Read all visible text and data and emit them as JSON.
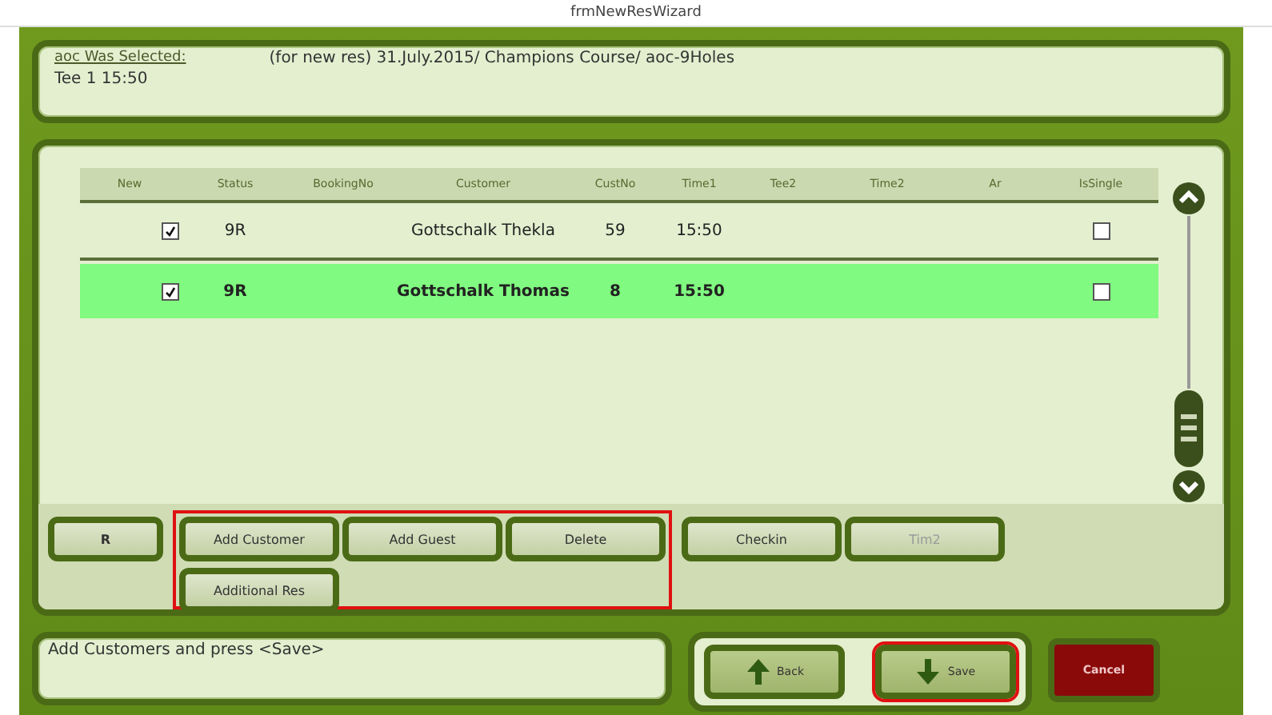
{
  "window": {
    "title": "frmNewResWizard"
  },
  "info": {
    "label": "aoc Was Selected:",
    "details": "(for new res) 31.July.2015/ Champions Course/ aoc-9Holes",
    "tee": "Tee 1 15:50"
  },
  "table": {
    "columns": [
      "New",
      "Status",
      "BookingNo",
      "Customer",
      "CustNo",
      "Time1",
      "Tee2",
      "Time2",
      "Ar",
      "IsSingle"
    ],
    "rows": [
      {
        "new": true,
        "status": "9R",
        "customer": "Gottschalk Thekla",
        "cust_no": "59",
        "time1": "15:50",
        "is_single": false,
        "selected": false
      },
      {
        "new": true,
        "status": "9R",
        "customer": "Gottschalk Thomas",
        "cust_no": "8",
        "time1": "15:50",
        "is_single": false,
        "selected": true
      }
    ]
  },
  "button_groups": [
    {
      "highlighted": false,
      "buttons": [
        {
          "label": "R",
          "disabled": false
        }
      ]
    },
    {
      "highlighted": true,
      "buttons": [
        {
          "label": "Add Customer",
          "disabled": false
        },
        {
          "label": "Add Guest",
          "disabled": false
        },
        {
          "label": "Delete",
          "disabled": false
        },
        {
          "label": "Additional Res",
          "disabled": false
        }
      ]
    },
    {
      "highlighted": false,
      "buttons": [
        {
          "label": "Checkin",
          "disabled": false
        },
        {
          "label": "Tim2",
          "disabled": true
        }
      ]
    }
  ],
  "message": "Add Customers and press <Save>",
  "nav": [
    {
      "kind": "back",
      "label": "Back",
      "highlighted": false
    },
    {
      "kind": "save",
      "label": "Save",
      "highlighted": true
    }
  ],
  "cancel": {
    "label": "Cancel"
  }
}
